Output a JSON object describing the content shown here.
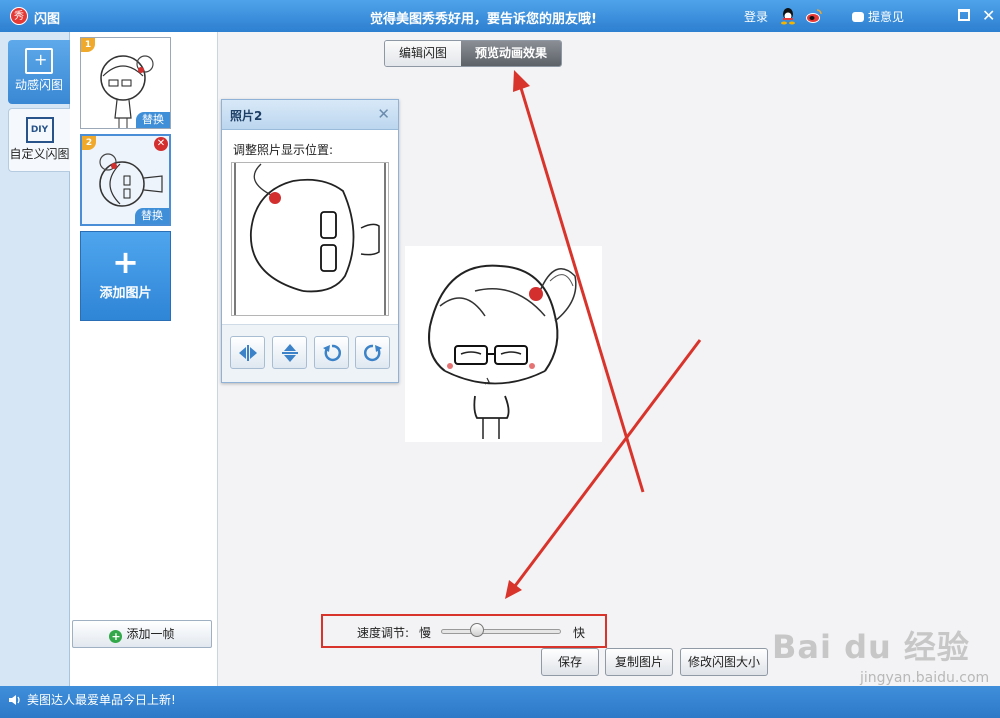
{
  "titlebar": {
    "logo": "秀",
    "title": "闪图",
    "slogan": "觉得美图秀秀好用，要告诉您的朋友哦!",
    "login": "登录",
    "feedback": "提意见"
  },
  "leftnav": {
    "items": [
      {
        "label": "动感闪图",
        "active": true
      },
      {
        "label": "自定义闪图",
        "icon_text": "DIY",
        "active": false
      }
    ]
  },
  "frames": {
    "items": [
      {
        "number": "1",
        "replace": "替换",
        "selected": false
      },
      {
        "number": "2",
        "replace": "替换",
        "selected": true
      }
    ],
    "add_image": "添加图片",
    "add_frame": "添加一帧"
  },
  "tabs": [
    {
      "label": "编辑闪图",
      "active": false
    },
    {
      "label": "预览动画效果",
      "active": true
    }
  ],
  "photo_panel": {
    "title": "照片2",
    "instruction": "调整照片显示位置:",
    "tools": [
      "flip-horizontal-icon",
      "flip-vertical-icon",
      "rotate-left-icon",
      "rotate-right-icon"
    ]
  },
  "speed": {
    "label": "速度调节:",
    "slow": "慢",
    "fast": "快",
    "level": 0.3
  },
  "actions": {
    "save": "保存",
    "copy": "复制图片",
    "resize": "修改闪图大小"
  },
  "statusbar": {
    "text": "美图达人最爱单品今日上新!"
  },
  "watermark": {
    "main": "Bai du 经验",
    "sub": "jingyan.baidu.com"
  },
  "colors": {
    "accent": "#3a88d4",
    "highlight": "#d9342b"
  }
}
